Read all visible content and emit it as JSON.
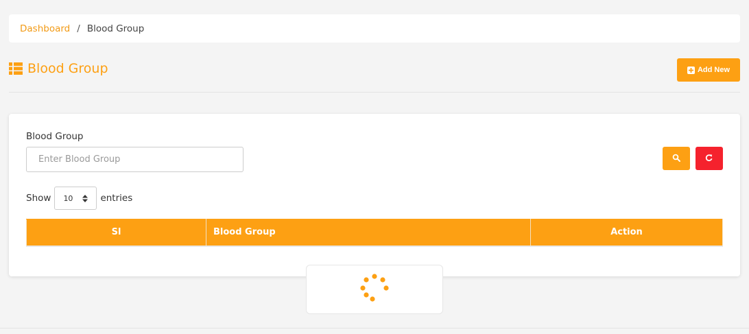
{
  "breadcrumb": {
    "home_label": "Dashboard",
    "separator": "/",
    "current_label": "Blood Group"
  },
  "header": {
    "title": "Blood Group",
    "title_icon": "list-icon",
    "add_button_label": "Add New",
    "add_button_icon": "plus-square-icon"
  },
  "filter": {
    "label": "Blood Group",
    "input_value": "",
    "input_placeholder": "Enter Blood Group",
    "search_icon": "search-icon",
    "reset_icon": "refresh-icon"
  },
  "entries": {
    "show_label": "Show",
    "selected": "10",
    "suffix_label": "entries"
  },
  "table": {
    "columns": [
      "Sl",
      "Blood Group",
      "Action"
    ],
    "rows": []
  },
  "loader": {
    "icon": "spinner-icon"
  },
  "colors": {
    "accent": "#fda013",
    "danger": "#f5222d",
    "link": "#f29a15",
    "background": "#f4f4f4"
  }
}
